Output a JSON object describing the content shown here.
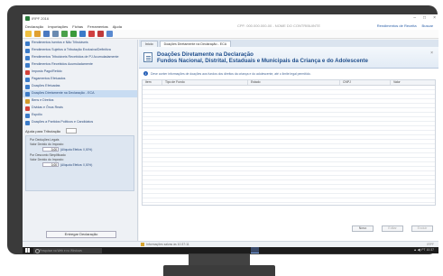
{
  "window": {
    "title": "IRPF 2016",
    "controls": [
      "–",
      "□",
      "×"
    ]
  },
  "menubar": {
    "items": [
      "Declaração",
      "Importações",
      "Fichas",
      "Ferramentas",
      "Ajuda"
    ],
    "center_info": "CPF: 000.000.000-00  -  NOME DO CONTRIBUINTE",
    "right_links": [
      "Rendimentos de Receita",
      "Buscar"
    ]
  },
  "toolbar": {
    "icons": [
      "new-icon",
      "open-icon",
      "save-icon",
      "print-icon",
      "calc-icon",
      "check-icon",
      "send-icon",
      "close-icon",
      "pdf-icon",
      "help-icon"
    ]
  },
  "sidebar": {
    "items": [
      {
        "label": "Rendimentos Isentos e Não Tributáveis",
        "icon_color": "#3b7bc8"
      },
      {
        "label": "Rendimentos Sujeitos à Tributação Exclusiva/Definitiva",
        "icon_color": "#3b7bc8"
      },
      {
        "label": "Rendimentos Tributáveis Recebidos de PJ Acumuladamente",
        "icon_color": "#3b7bc8"
      },
      {
        "label": "Rendimentos Recebidos Acumuladamente",
        "icon_color": "#3b7bc8"
      },
      {
        "label": "Imposto Pago/Retido",
        "icon_color": "#d3423a"
      },
      {
        "label": "Pagamentos Efetuados",
        "icon_color": "#3b7bc8"
      },
      {
        "label": "Doações Efetuadas",
        "icon_color": "#3b7bc8"
      },
      {
        "label": "Doações Diretamente na Declaração - ECA",
        "icon_color": "#3b7bc8"
      },
      {
        "label": "Bens e Direitos",
        "icon_color": "#d39a2a"
      },
      {
        "label": "Dívidas e Ônus Reais",
        "icon_color": "#d3423a"
      },
      {
        "label": "Espólio",
        "icon_color": "#3b7bc8"
      },
      {
        "label": "Doações a Partidos Políticos e Candidatos",
        "icon_color": "#3b7bc8"
      }
    ],
    "selected_index": 7,
    "ajuda": {
      "title": "Ajuda para Tributação",
      "rows": [
        {
          "heading": "Por Deduções Legais",
          "caption": "Valor Devido do Imposto:",
          "value": "0,00",
          "link": "(Alíquota Efetiva: 0,00%)"
        },
        {
          "heading": "Por Desconto Simplificado",
          "caption": "Valor Devido do Imposto:",
          "value": "0,00",
          "link": "(Alíquota Efetiva: 0,00%)"
        }
      ]
    },
    "print_button": "Entregar Declaração"
  },
  "main": {
    "tabs": [
      "Início",
      "Doações Diretamente na Declaração - ECA"
    ],
    "banner_title_line1": "Doações Diretamente na Declaração",
    "banner_title_line2": "Fundos Nacional, Distrital, Estaduais e Municipais da Criança e do Adolescente",
    "close_label": "×",
    "info_text": "Deve conter informações de doações aos fundos dos direitos da criança e do adolescente, até o limite legal permitido.",
    "columns": [
      "Item",
      "Tipo de Fundo",
      "Estado",
      "CNPJ",
      "Valor"
    ],
    "rows_count_hint": "",
    "buttons": [
      {
        "label": "Novo",
        "disabled": false
      },
      {
        "label": "Editar",
        "disabled": true
      },
      {
        "label": "Excluir",
        "disabled": true
      }
    ]
  },
  "statusbar": {
    "text": "Informações salvas às 10:37:11",
    "right": "IRPF"
  },
  "taskbar": {
    "search_placeholder": "Pesquisar na Web e no Windows",
    "tray_text": "▲  ◀)  PT  10:37"
  }
}
